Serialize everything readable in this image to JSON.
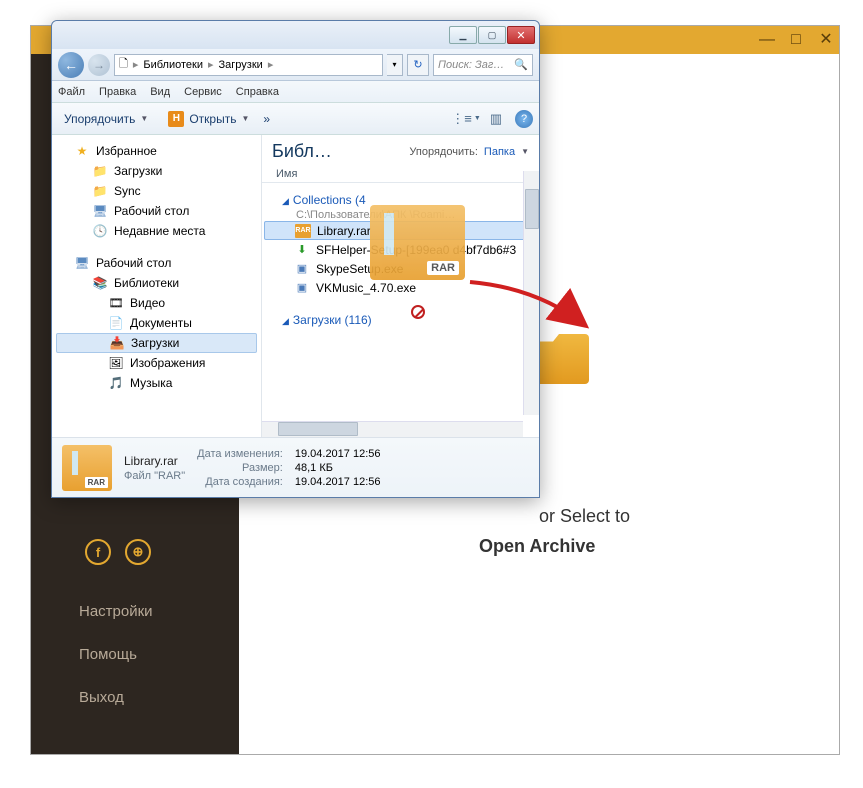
{
  "bgApp": {
    "winBtns": {
      "min": "—",
      "max": "□",
      "close": "✕"
    },
    "social": {
      "fb": "f",
      "web": "⊕"
    },
    "links": {
      "settings": "Настройки",
      "help": "Помощь",
      "exit": "Выход"
    },
    "dropText1": "or Select to",
    "dropText2": "Open Archive"
  },
  "explorer": {
    "winBtns": {
      "min": "▁",
      "max": "▢",
      "close": "✕"
    },
    "nav": {
      "back": "←",
      "fwd": "→"
    },
    "breadcrumb": {
      "icon": "🗋",
      "seg1": "Библиотеки",
      "seg2": "Загрузки",
      "sep": "▸",
      "drop": "▾",
      "refresh": "↻"
    },
    "search": {
      "placeholder": "Поиск: Заг…",
      "icon": "🔍"
    },
    "menu": {
      "file": "Файл",
      "edit": "Правка",
      "view": "Вид",
      "service": "Сервис",
      "help": "Справка"
    },
    "toolbar": {
      "organize": "Упорядочить",
      "openLabel": "Открыть",
      "more": "»",
      "viewIc": "⋮≡",
      "paneIc": "▥",
      "help": "?"
    },
    "navPane": {
      "favorites": "Избранное",
      "downloads": "Загрузки",
      "sync": "Sync",
      "desktop": "Рабочий стол",
      "recent": "Недавние места",
      "desktop2": "Рабочий стол",
      "libraries": "Библиотеки",
      "video": "Видео",
      "documents": "Документы",
      "downloads2": "Загрузки",
      "images": "Изображения",
      "music": "Музыка"
    },
    "content": {
      "title": "Библ…",
      "sortLabel": "Упорядочить:",
      "sortValue": "Папка",
      "colName": "Имя",
      "group1": "Collections (4",
      "group1sub": "C:\\Пользователи\\АПК             \\Roami…",
      "file1": "Library.rar",
      "file2": "SFHelper-Setup-[199ea0     d4bf7db6#3",
      "file3": "SkypeSetup.exe",
      "file4": "VKMusic_4.70.exe",
      "group2": "Загрузки (116)"
    },
    "details": {
      "name": "Library.rar",
      "type": "Файл \"RAR\"",
      "modLabel": "Дата изменения:",
      "modVal": "19.04.2017 12:56",
      "sizeLabel": "Размер:",
      "sizeVal": "48,1 КБ",
      "createLabel": "Дата создания:",
      "createVal": "19.04.2017 12:56"
    }
  }
}
